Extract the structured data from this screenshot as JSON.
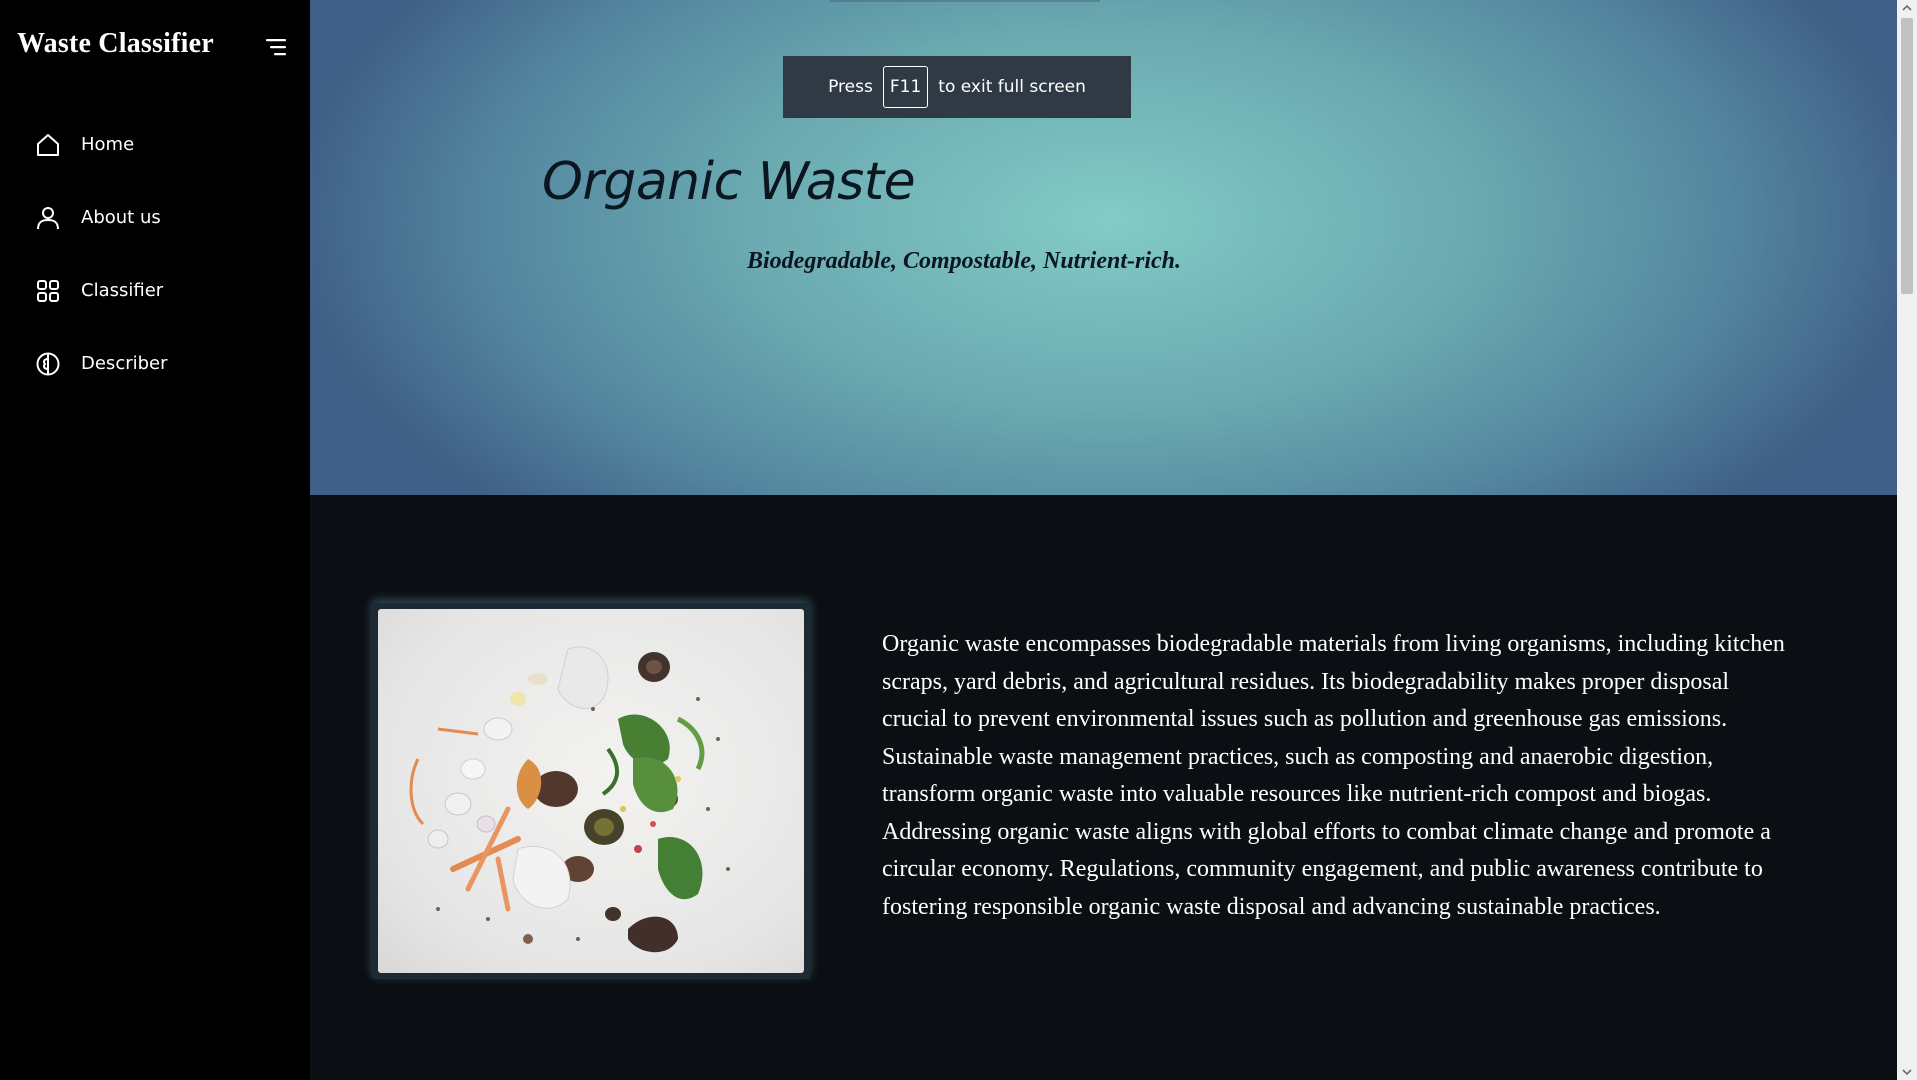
{
  "sidebar": {
    "brand": "Waste Classifier",
    "toggle_icon": "menu-lines-icon",
    "items": [
      {
        "label": "Home",
        "icon": "home-icon"
      },
      {
        "label": "About us",
        "icon": "user-icon"
      },
      {
        "label": "Classifier",
        "icon": "grid-icon"
      },
      {
        "label": "Describer",
        "icon": "brain-icon"
      }
    ]
  },
  "fullscreen_notice": {
    "prefix": "Press",
    "key": "F11",
    "suffix": "to exit full screen"
  },
  "hero": {
    "title": "Organic Waste",
    "subtitle": "Biodegradable, Compostable, Nutrient-rich."
  },
  "content": {
    "image_description": "organic waste scraps photo",
    "paragraph": "Organic waste encompasses biodegradable materials from living organisms, including kitchen scraps, yard debris, and agricultural residues. Its biodegradability makes proper disposal crucial to prevent environmental issues such as pollution and greenhouse gas emissions. Sustainable waste management practices, such as composting and anaerobic digestion, transform organic waste into valuable resources like nutrient-rich compost and biogas. Addressing organic waste aligns with global efforts to combat climate change and promote a circular economy. Regulations, community engagement, and public awareness contribute to fostering responsible organic waste disposal and advancing sustainable practices."
  },
  "colors": {
    "sidebar_bg": "#000000",
    "page_bg": "#0b0e12",
    "hero_center": "#82cbc6",
    "hero_edge": "#3f5f86",
    "text_light": "#ffffff",
    "text_dark": "#0c1620"
  }
}
